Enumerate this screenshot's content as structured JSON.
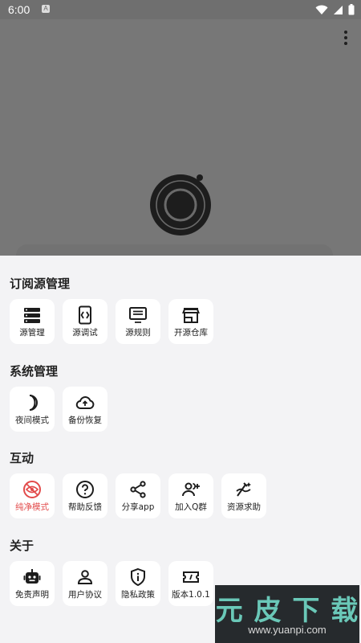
{
  "status_bar": {
    "time": "6:00",
    "notification_label": "A"
  },
  "sections": [
    {
      "title": "订阅源管理",
      "items": [
        {
          "label": "源管理",
          "icon": "source-manage-icon"
        },
        {
          "label": "源调试",
          "icon": "source-debug-icon"
        },
        {
          "label": "源规则",
          "icon": "source-rules-icon"
        },
        {
          "label": "开源仓库",
          "icon": "store-icon"
        }
      ]
    },
    {
      "title": "系统管理",
      "items": [
        {
          "label": "夜间模式",
          "icon": "moon-icon"
        },
        {
          "label": "备份恢复",
          "icon": "cloud-upload-icon"
        }
      ]
    },
    {
      "title": "互动",
      "items": [
        {
          "label": "纯净模式",
          "icon": "eye-off-icon",
          "active": true
        },
        {
          "label": "帮助反馈",
          "icon": "help-icon"
        },
        {
          "label": "分享app",
          "icon": "share-icon"
        },
        {
          "label": "加入Q群",
          "icon": "add-group-icon"
        },
        {
          "label": "资源求助",
          "icon": "resource-request-icon"
        }
      ]
    },
    {
      "title": "关于",
      "items": [
        {
          "label": "免责声明",
          "icon": "robot-icon"
        },
        {
          "label": "用户协议",
          "icon": "user-icon"
        },
        {
          "label": "隐私政策",
          "icon": "shield-info-icon"
        },
        {
          "label": "版本1.0.1",
          "icon": "ticket-icon"
        }
      ]
    }
  ],
  "watermark": {
    "title": "元 皮 下 载",
    "url": "www.yuanpi.com"
  },
  "colors": {
    "accent_active": "#e24a4a",
    "sheet_bg": "#f3f3f5",
    "overlay": "#777777"
  }
}
